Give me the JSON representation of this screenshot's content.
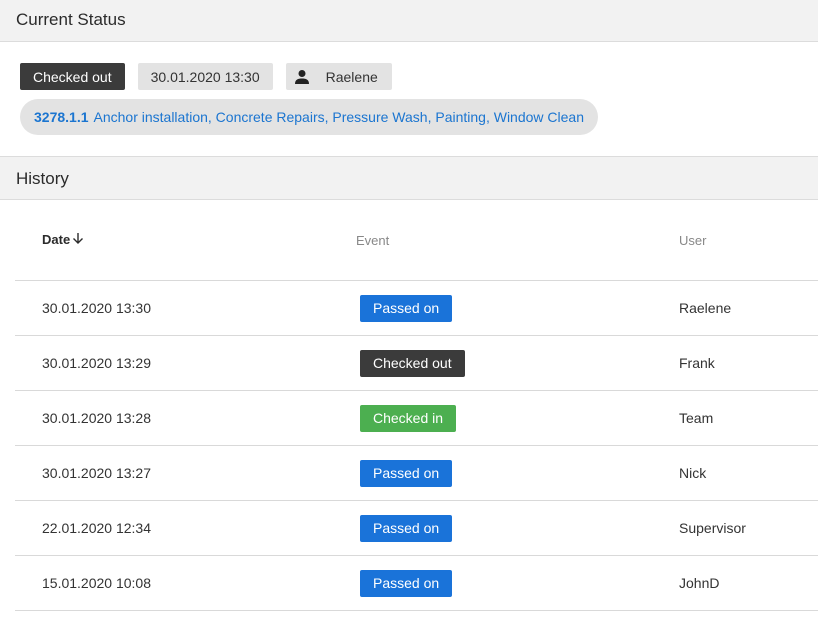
{
  "current_status": {
    "title": "Current Status",
    "status_label": "Checked out",
    "timestamp": "30.01.2020 13:30",
    "user": "Raelene",
    "job_code": "3278.1.1",
    "job_description": "Anchor installation, Concrete Repairs, Pressure Wash, Painting, Window Clean"
  },
  "history": {
    "title": "History",
    "columns": {
      "date": "Date",
      "event": "Event",
      "user": "User"
    },
    "rows": [
      {
        "date": "30.01.2020 13:30",
        "event": "Passed on",
        "user": "Raelene"
      },
      {
        "date": "30.01.2020 13:29",
        "event": "Checked out",
        "user": "Frank"
      },
      {
        "date": "30.01.2020 13:28",
        "event": "Checked in",
        "user": "Team"
      },
      {
        "date": "30.01.2020 13:27",
        "event": "Passed on",
        "user": "Nick"
      },
      {
        "date": "22.01.2020 12:34",
        "event": "Passed on",
        "user": "Supervisor"
      },
      {
        "date": "15.01.2020 10:08",
        "event": "Passed on",
        "user": "JohnD"
      }
    ]
  },
  "colors": {
    "passed_on": "#1a73d9",
    "checked_out": "#3b3b3b",
    "checked_in": "#4caf50",
    "link": "#1b75d0"
  },
  "icons": {
    "user": "person-icon",
    "sort": "arrow-down-icon"
  }
}
